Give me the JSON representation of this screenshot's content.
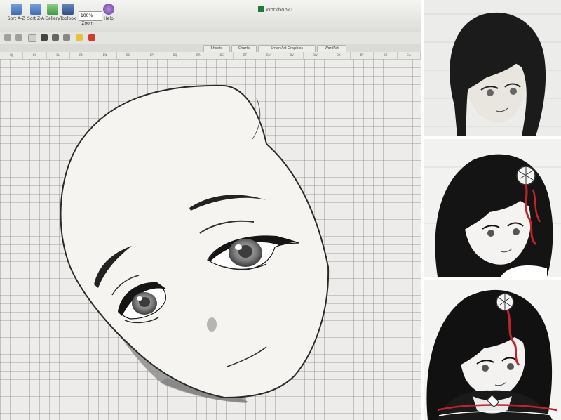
{
  "excel": {
    "ribbon": {
      "buttons": [
        {
          "label": "Sort A-Z",
          "icon": "sort-ascending-icon"
        },
        {
          "label": "Sort Z-A",
          "icon": "sort-descending-icon"
        },
        {
          "label": "Gallery",
          "icon": "gallery-icon"
        },
        {
          "label": "Toolbox",
          "icon": "toolbox-icon"
        },
        {
          "label": "Zoom",
          "icon": "zoom-icon"
        },
        {
          "label": "Help",
          "icon": "help-icon"
        }
      ],
      "zoom_value": "100%"
    },
    "window_title": "Workbook1",
    "tabs": [
      "Sheets",
      "Charts",
      "SmartArt Graphics",
      "WordArt"
    ],
    "column_headers": [
      "BJ",
      "BK",
      "BL",
      "BM",
      "BN",
      "BO",
      "BP",
      "BQ",
      "BR",
      "BS",
      "BT",
      "BU",
      "BV",
      "BW",
      "BX",
      "BY",
      "BZ",
      "CA"
    ],
    "drawing": "anime-face-shape",
    "colors": {
      "ribbon": "#e8e8e4",
      "grid_line": "#9a9a9a",
      "face_fill": "#f6f6f4",
      "outline": "#2a2a2a"
    }
  },
  "panels": [
    {
      "name": "illustration-1",
      "subject": "girl-portrait-sketch"
    },
    {
      "name": "illustration-2",
      "subject": "girl-portrait-with-hair-ornament"
    },
    {
      "name": "illustration-3",
      "subject": "girl-portrait-in-uniform"
    }
  ]
}
